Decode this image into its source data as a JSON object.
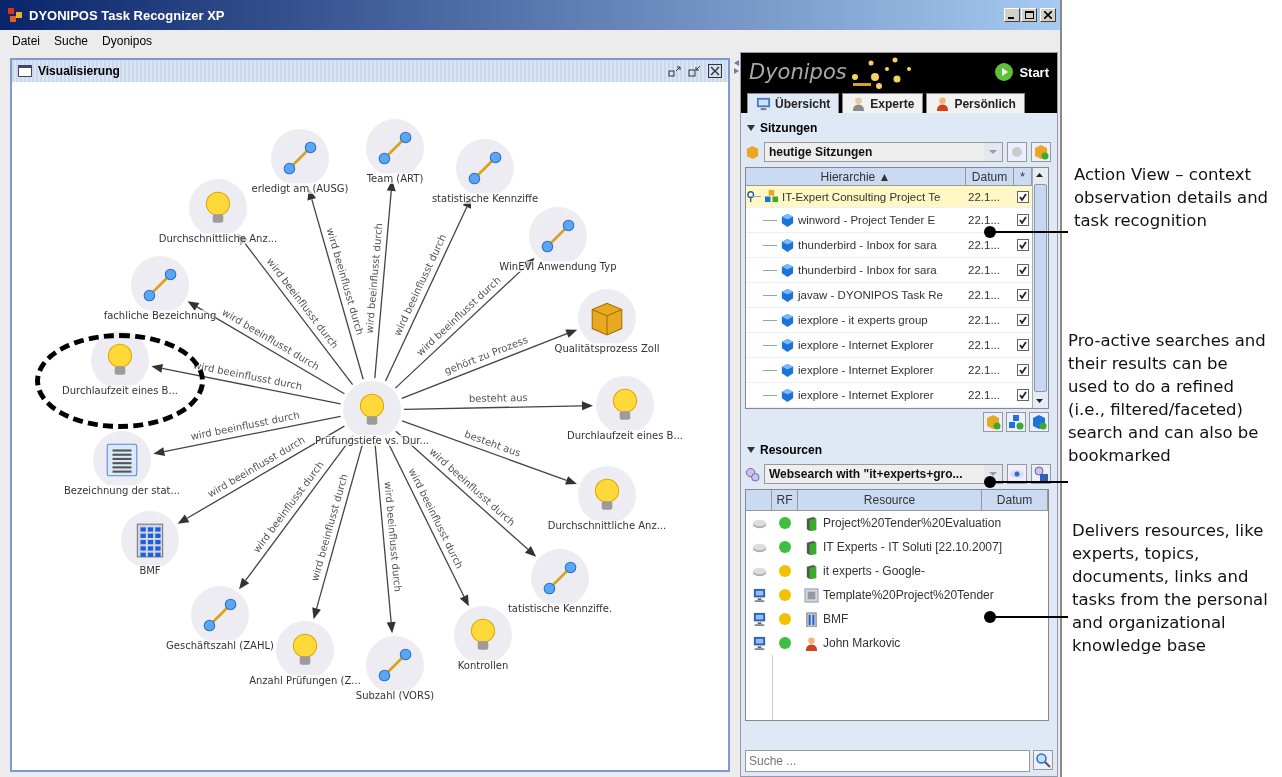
{
  "window": {
    "title": "DYONIPOS Task Recognizer XP"
  },
  "menu": [
    "Datei",
    "Suche",
    "Dyonipos"
  ],
  "visualization": {
    "title": "Visualisierung",
    "center": {
      "label": "Prüfungstiefe vs. Dur...",
      "kind": "bulb"
    },
    "nodes": [
      {
        "label": "Team (ART)",
        "kind": "attribute",
        "edge_label": "wird beeinflusst durch",
        "highlighted": false
      },
      {
        "label": "erledigt am (AUSG)",
        "kind": "attribute",
        "edge_label": "wird beeinflusst durch",
        "highlighted": false
      },
      {
        "label": "statistische Kennziffe",
        "kind": "attribute",
        "edge_label": "wird beeinflusst durch",
        "highlighted": false
      },
      {
        "label": "Durchschnittliche Anz...",
        "kind": "bulb",
        "edge_label": "wird beeinflusst durch",
        "highlighted": false
      },
      {
        "label": "WinEVI Anwendung Typ",
        "kind": "attribute",
        "edge_label": "wird beeinflusst durch",
        "highlighted": false
      },
      {
        "label": "fachliche Bezeichnung",
        "kind": "attribute",
        "edge_label": "wird beeinflusst durch",
        "highlighted": false
      },
      {
        "label": "Qualitätsprozess Zoll",
        "kind": "cube",
        "edge_label": "gehört zu Prozess",
        "highlighted": false
      },
      {
        "label": "Durchlaufzeit eines B...",
        "kind": "bulb",
        "edge_label": "wird beeinflusst durch",
        "highlighted": true
      },
      {
        "label": "Durchlaufzeit eines B...",
        "kind": "bulb",
        "edge_label": "besteht aus",
        "highlighted": false
      },
      {
        "label": "Bezeichnung der stat...",
        "kind": "list",
        "edge_label": "wird beeinflusst durch",
        "highlighted": false
      },
      {
        "label": "Durchschnittliche Anz...",
        "kind": "bulb",
        "edge_label": "besteht aus",
        "highlighted": false
      },
      {
        "label": "BMF",
        "kind": "building",
        "edge_label": "wird beeinflusst durch",
        "highlighted": false
      },
      {
        "label": "tatistische Kennziffe.",
        "kind": "attribute",
        "edge_label": "wird beeinflusst durch",
        "highlighted": false
      },
      {
        "label": "Geschäftszahl (ZAHL)",
        "kind": "attribute",
        "edge_label": "wird beeinflusst durch",
        "highlighted": false
      },
      {
        "label": "Kontrollen",
        "kind": "bulb",
        "edge_label": "wird beeinflusst durch",
        "highlighted": false
      },
      {
        "label": "Anzahl Prüfungen (Z...",
        "kind": "bulb",
        "edge_label": "wird beeinflusst durch",
        "highlighted": false
      },
      {
        "label": "Subzahl (VORS)",
        "kind": "attribute",
        "edge_label": "wird beeinflusst durch",
        "highlighted": false
      }
    ]
  },
  "sidebar": {
    "logo": "Dyonipos",
    "start_button": "Start",
    "tabs": [
      {
        "label": "Übersicht",
        "kind": "overview",
        "selected": true
      },
      {
        "label": "Experte",
        "kind": "expert",
        "selected": false
      },
      {
        "label": "Persönlich",
        "kind": "personal",
        "selected": false
      }
    ],
    "sessions": {
      "title": "Sitzungen",
      "expanded": true,
      "filter": "heutige Sitzungen",
      "columns": [
        "Hierarchie ▲",
        "Datum",
        "*"
      ],
      "rows": [
        {
          "label": "IT-Expert Consulting Project Te",
          "date": "22.1...",
          "checked": true,
          "selected": true,
          "children": [
            {
              "label": "winword - Project Tender E",
              "date": "22.1...",
              "checked": true,
              "selected": false
            },
            {
              "label": "thunderbird - Inbox for sara",
              "date": "22.1...",
              "checked": true,
              "selected": false
            },
            {
              "label": "thunderbird - Inbox for sara",
              "date": "22.1...",
              "checked": true,
              "selected": false
            },
            {
              "label": "javaw - DYONIPOS Task Re",
              "date": "22.1...",
              "checked": true,
              "selected": false
            },
            {
              "label": "iexplore - it experts group",
              "date": "22.1...",
              "checked": true,
              "selected": false
            },
            {
              "label": "iexplore - Internet Explorer",
              "date": "22.1...",
              "checked": true,
              "selected": false
            },
            {
              "label": "iexplore - Internet Explorer",
              "date": "22.1...",
              "checked": true,
              "selected": false
            },
            {
              "label": "iexplore - Internet Explorer",
              "date": "22.1...",
              "checked": true,
              "selected": false
            }
          ]
        }
      ]
    },
    "resources": {
      "title": "Resourcen",
      "expanded": true,
      "query": "Websearch with \"it+experts+gro...",
      "columns": [
        "RF",
        "Resource",
        "Datum"
      ],
      "rows": [
        {
          "local": false,
          "color": "#3cbf3c",
          "kind": "book",
          "label": "Project%20Tender%20Evaluation"
        },
        {
          "local": false,
          "color": "#3cbf3c",
          "kind": "book",
          "label": "IT Experts - IT Soluti [22.10.2007]"
        },
        {
          "local": false,
          "color": "#f2c200",
          "kind": "book",
          "label": "it experts - Google-"
        },
        {
          "local": true,
          "color": "#f2c200",
          "kind": "document",
          "label": "Template%20Project%20Tender"
        },
        {
          "local": true,
          "color": "#f2c200",
          "kind": "building",
          "label": "BMF"
        },
        {
          "local": true,
          "color": "#3cbf3c",
          "kind": "person",
          "label": "John Markovic"
        }
      ]
    },
    "search": {
      "placeholder": "Suche ..."
    }
  },
  "annotations": [
    {
      "text": "Action View – context observation details and task recognition"
    },
    {
      "text": "Pro-active searches and their results can be used to do a refined (i.e., filtered/faceted) search and can also be bookmarked"
    },
    {
      "text": "Delivers resources, like experts, topics, documents, links and tasks from the personal and organizational knowledge base"
    }
  ]
}
